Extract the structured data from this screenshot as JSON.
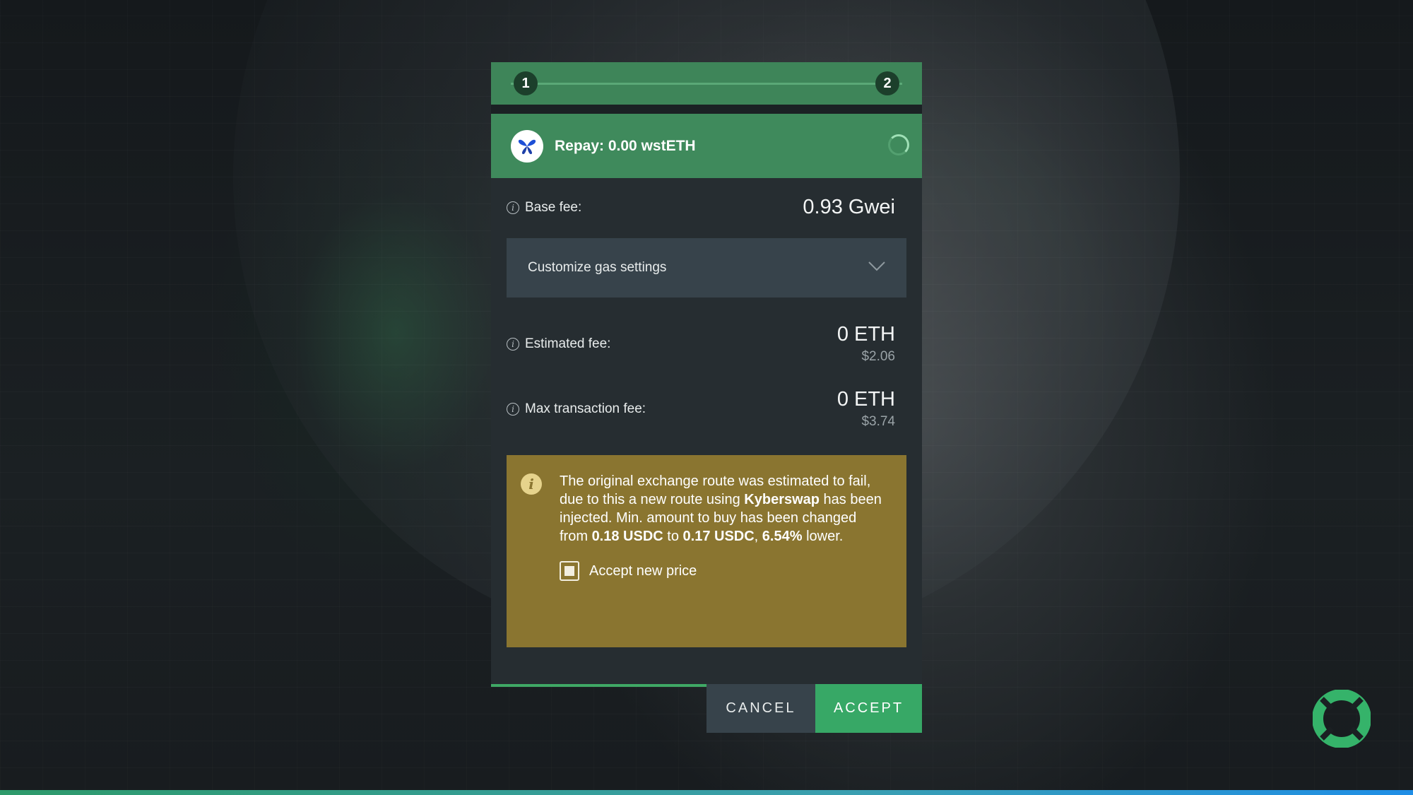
{
  "stepper": {
    "step1": "1",
    "step2": "2"
  },
  "header": {
    "title": "Repay: 0.00 wstETH",
    "logo_icon": "butterfly-token-icon"
  },
  "base_fee": {
    "label": "Base fee:",
    "value": "0.93 Gwei"
  },
  "gas_settings": {
    "label": "Customize gas settings"
  },
  "estimated_fee": {
    "label": "Estimated fee:",
    "eth": "0 ETH",
    "usd": "$2.06"
  },
  "max_fee": {
    "label": "Max transaction fee:",
    "eth": "0 ETH",
    "usd": "$3.74"
  },
  "warning": {
    "t1": "The original exchange route was estimated to fail, due to this a new route using ",
    "b1": "Kyberswap",
    "t2": " has been injected. Min. amount to buy has been changed from ",
    "b2": "0.18 USDC",
    "t3": " to ",
    "b3": "0.17 USDC",
    "t4": ", ",
    "b4": "6.54%",
    "t5": " lower.",
    "accept_label": "Accept new price",
    "accept_checked": true
  },
  "actions": {
    "cancel": "CANCEL",
    "accept": "ACCEPT"
  },
  "colors": {
    "accent": "#37a866",
    "warning_bg": "#8a7530",
    "panel_bg": "#262d31"
  }
}
